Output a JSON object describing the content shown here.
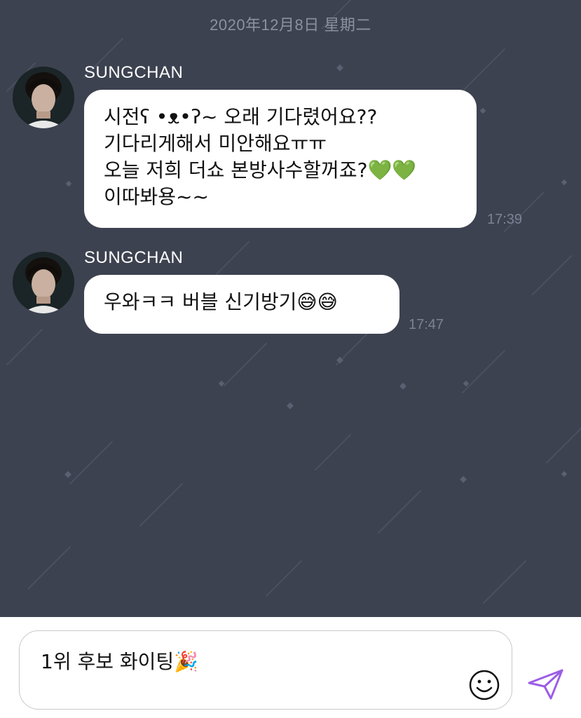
{
  "chat": {
    "date_divider": "2020年12月8日 星期二",
    "messages": [
      {
        "sender": "SUNGCHAN",
        "lines": [
          "시전ʕ •ᴥ•ʔ~ 오래 기다렸어요??",
          "기다리게해서 미안해요ㅠㅠ",
          "오늘 저희 더쇼 본방사수할꺼죠?💚💚",
          "이따봐용~~"
        ],
        "time": "17:39"
      },
      {
        "sender": "SUNGCHAN",
        "lines": [
          "우와ㅋㅋ 버블 신기방기😅😅"
        ],
        "time": "17:47"
      }
    ]
  },
  "composer": {
    "text": "1위 후보 화이팅🎉",
    "emoji_icon": "smiley-icon",
    "send_icon": "paper-plane-icon",
    "accent_color": "#9b5de5"
  },
  "colors": {
    "chat_background": "#3d4250",
    "bubble": "#ffffff",
    "timestamp": "#7d8394"
  }
}
